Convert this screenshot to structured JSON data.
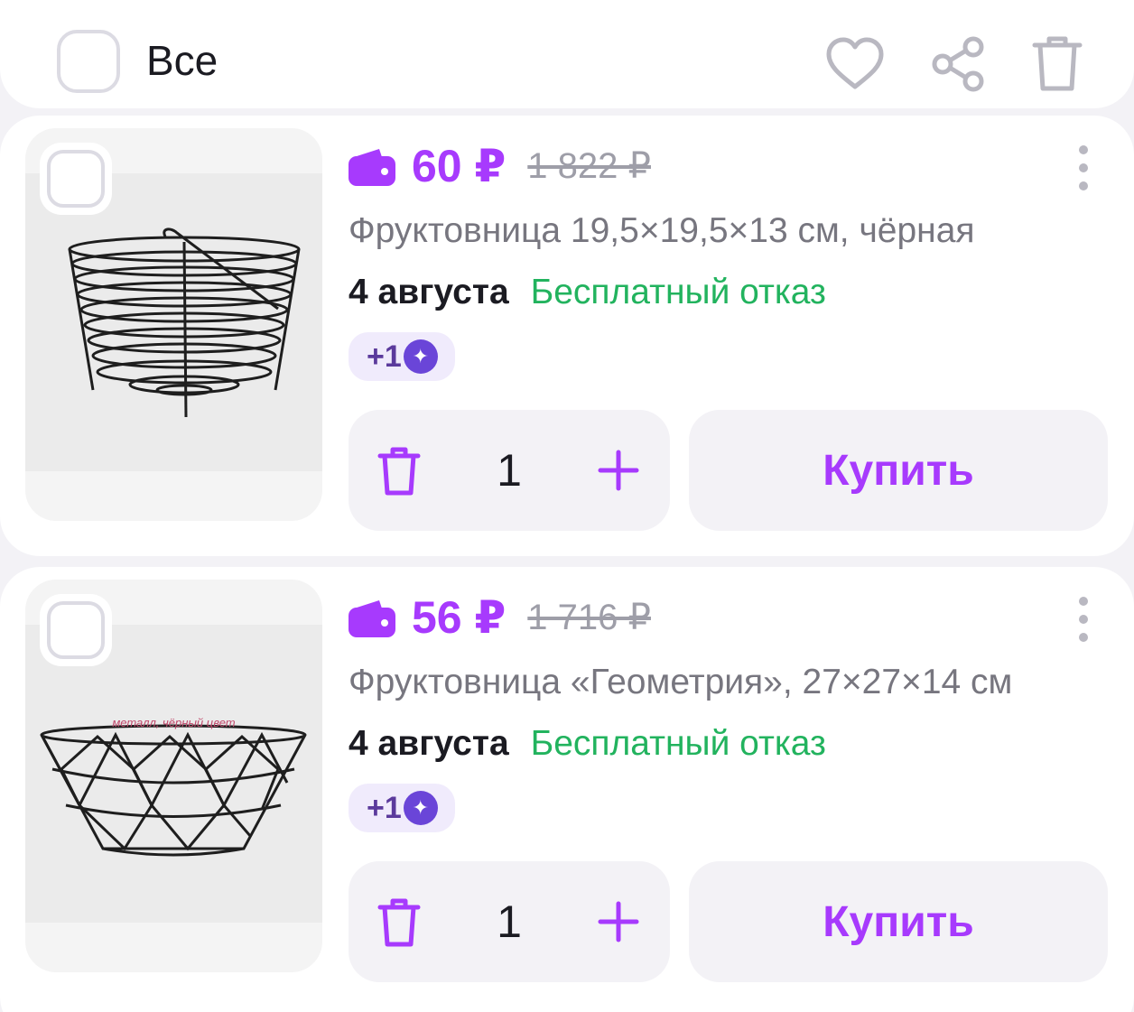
{
  "header": {
    "select_all_label": "Все",
    "icons": [
      "heart-icon",
      "share-icon",
      "trash-icon"
    ]
  },
  "colors": {
    "accent": "#a73afd",
    "green": "#22b35e",
    "muted": "#77767f",
    "bonus_bg": "#f0ebfc"
  },
  "items": [
    {
      "price": "60 ₽",
      "old_price": "1 822 ₽",
      "title": "Фруктовница 19,5×19,5×13 см, чёрная",
      "delivery_date": "4 августа",
      "refund": "Бесплатный отказ",
      "bonus": "+1",
      "quantity": "1",
      "buy_label": "Купить"
    },
    {
      "price": "56 ₽",
      "old_price": "1 716 ₽",
      "title": "Фруктовница «Геометрия», 27×27×14 см",
      "delivery_date": "4 августа",
      "refund": "Бесплатный отказ",
      "bonus": "+1",
      "quantity": "1",
      "buy_label": "Купить",
      "photo_caption": "металл, чёрный цвет"
    }
  ]
}
